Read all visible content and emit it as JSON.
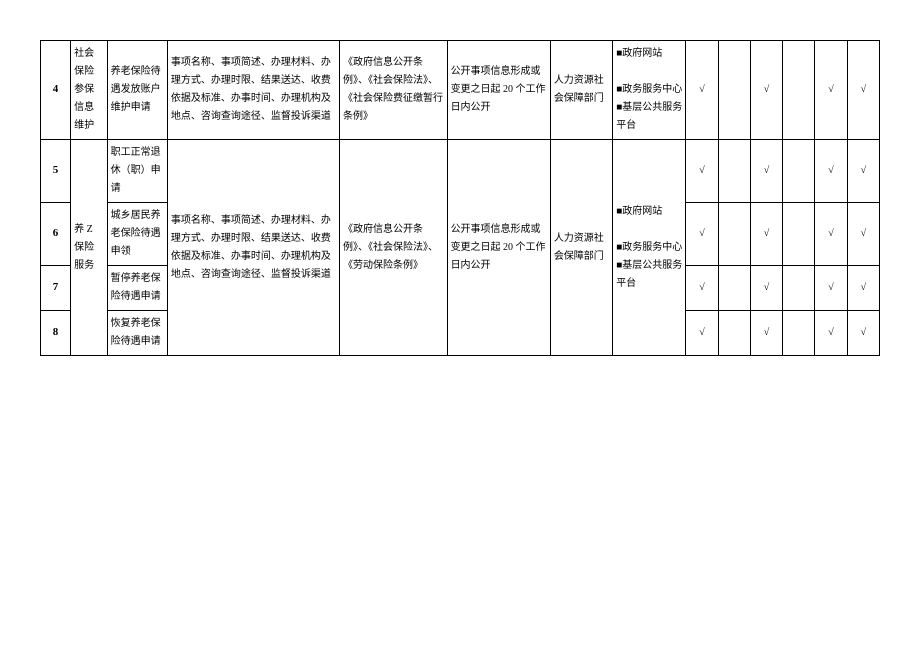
{
  "check": "√",
  "block_mark": "■",
  "row4": {
    "num": "4",
    "category": "社会保险参保信息维护",
    "item": "养老保险待遇发放账户维护申请",
    "content": "事项名称、事项简述、办理材料、办理方式、办理时限、结果送达、收费依据及标准、办事时间、办理机构及地点、咨询查询途径、监督投诉渠道",
    "basis": "《政府信息公开条例》、《社会保险法》、《社会保险费征缴暂行条例》",
    "time": "公开事项信息形成或变更之日起 20 个工作日内公开",
    "dept": "人力资源社会保障部门",
    "channel1": "政府网站",
    "channel2": "政务服务中心",
    "channel3": "基层公共服务平台"
  },
  "row5": {
    "num": "5",
    "item": "职工正常退休（职）申请"
  },
  "row6": {
    "num": "6",
    "item": "城乡居民养老保险待遇申领"
  },
  "row7": {
    "num": "7",
    "item": "暂停养老保险待遇申请"
  },
  "row8": {
    "num": "8",
    "item": "恢复养老保险待遇申请"
  },
  "block58": {
    "category": "养 Z 保险服务",
    "content": "事项名称、事项简述、办理材料、办理方式、办理时限、结果送达、收费依据及标准、办事时间、办理机构及地点、咨询查询途径、监督投诉渠道",
    "basis": "《政府信息公开条例》、《社会保险法》、《劳动保险条例》",
    "time": "公开事项信息形成或变更之日起 20 个工作日内公开",
    "dept": "人力资源社会保障部门",
    "channel1": "政府网站",
    "channel2": "政务服务中心",
    "channel3": "基层公共服务平台"
  }
}
